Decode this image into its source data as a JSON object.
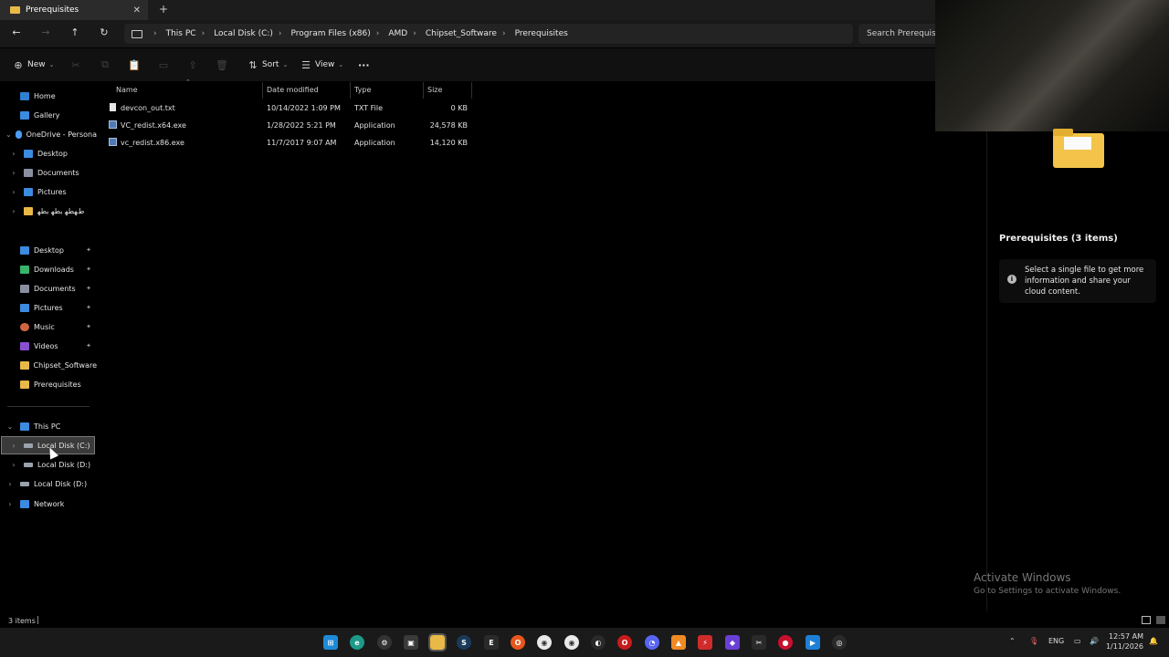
{
  "window": {
    "tab_title": "Prerequisites",
    "tab_close": "✕",
    "new_tab": "+"
  },
  "nav": {
    "back": "←",
    "forward": "→",
    "up": "↑",
    "refresh": "↻",
    "breadcrumbs": [
      "This PC",
      "Local Disk (C:)",
      "Program Files (x86)",
      "AMD",
      "Chipset_Software",
      "Prerequisites"
    ],
    "search_placeholder": "Search Prerequisites"
  },
  "toolbar": {
    "new_label": "New",
    "sort_label": "Sort",
    "view_label": "View",
    "more_label": "···"
  },
  "sidebar": {
    "quick": [
      {
        "label": "Home",
        "icon": "home-icon",
        "color": "#2f7fd0"
      },
      {
        "label": "Gallery",
        "icon": "gallery-icon",
        "color": "#3b8be0"
      },
      {
        "label": "OneDrive - Persona",
        "icon": "cloud-icon",
        "color": "#4a9df2"
      },
      {
        "label": "Desktop",
        "icon": "desktop-folder-icon",
        "color": "#3b8be0"
      },
      {
        "label": "Documents",
        "icon": "documents-folder-icon",
        "color": "#8a8fa0"
      },
      {
        "label": "Pictures",
        "icon": "pictures-folder-icon",
        "color": "#3b8be0"
      },
      {
        "label": "ﻁﻬﻄﻬ ﺑﻄﻬ ﺑﻄﻬ",
        "icon": "folder-icon",
        "color": "#e8b947"
      }
    ],
    "pinned": [
      {
        "label": "Desktop",
        "icon": "desktop-folder-icon",
        "color": "#3b8be0"
      },
      {
        "label": "Downloads",
        "icon": "download-icon",
        "color": "#37b36a"
      },
      {
        "label": "Documents",
        "icon": "documents-folder-icon",
        "color": "#8a8fa0"
      },
      {
        "label": "Pictures",
        "icon": "pictures-folder-icon",
        "color": "#3b8be0"
      },
      {
        "label": "Music",
        "icon": "music-icon",
        "color": "#d0653f"
      },
      {
        "label": "Videos",
        "icon": "videos-icon",
        "color": "#8a4fd1"
      },
      {
        "label": "Chipset_Software",
        "icon": "folder-icon",
        "color": "#e8b947"
      },
      {
        "label": "Prerequisites",
        "icon": "folder-icon",
        "color": "#e8b947"
      }
    ],
    "pin_glyph": "📌",
    "this_pc": "This PC",
    "drives": [
      "Local Disk (C:)",
      "Local Disk (D:)",
      "Local Disk (D:)"
    ],
    "network": "Network"
  },
  "columns": {
    "name": "Name",
    "date": "Date modified",
    "type": "Type",
    "size": "Size"
  },
  "files": [
    {
      "name": "devcon_out.txt",
      "date": "10/14/2022 1:09 PM",
      "type": "TXT File",
      "size": "0 KB"
    },
    {
      "name": "VC_redist.x64.exe",
      "date": "1/28/2022 5:21 PM",
      "type": "Application",
      "size": "24,578 KB"
    },
    {
      "name": "vc_redist.x86.exe",
      "date": "11/7/2017 9:07 AM",
      "type": "Application",
      "size": "14,120 KB"
    }
  ],
  "preview": {
    "title": "Prerequisites (3 items)",
    "info": "Select a single file to get more information and share your cloud content.",
    "info_icon": "i"
  },
  "watermark": {
    "line1": "Activate Windows",
    "line2": "Go to Settings to activate Windows."
  },
  "status": {
    "items": "3 items"
  },
  "taskbar": {
    "lang": "ENG",
    "time": "12:57 AM",
    "date": "1/11/2026"
  }
}
